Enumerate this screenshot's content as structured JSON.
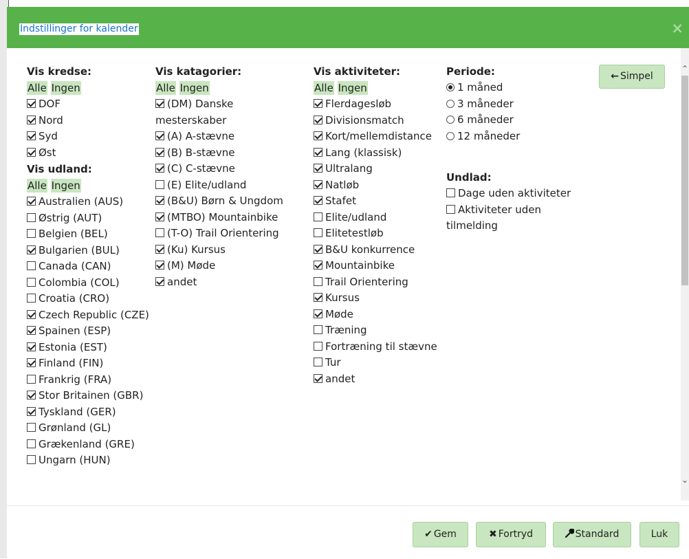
{
  "dialog": {
    "title": "Indstillinger for kalender",
    "close_symbol": "×",
    "simpel_label": "Simpel",
    "simpel_icon": "←"
  },
  "select_all_label": "Alle",
  "select_none_label": "Ingen",
  "kredse": {
    "heading": "Vis kredse:",
    "items": [
      {
        "label": "DOF",
        "checked": true
      },
      {
        "label": "Nord",
        "checked": true
      },
      {
        "label": "Syd",
        "checked": true
      },
      {
        "label": "Øst",
        "checked": true
      }
    ]
  },
  "udland": {
    "heading": "Vis udland:",
    "items": [
      {
        "label": "Australien (AUS)",
        "checked": true
      },
      {
        "label": "Østrig (AUT)",
        "checked": false
      },
      {
        "label": "Belgien (BEL)",
        "checked": false
      },
      {
        "label": "Bulgarien (BUL)",
        "checked": true
      },
      {
        "label": "Canada (CAN)",
        "checked": false
      },
      {
        "label": "Colombia (COL)",
        "checked": false
      },
      {
        "label": "Croatia (CRO)",
        "checked": false
      },
      {
        "label": "Czech Republic (CZE)",
        "checked": true
      },
      {
        "label": "Spainen (ESP)",
        "checked": true
      },
      {
        "label": "Estonia (EST)",
        "checked": true
      },
      {
        "label": "Finland (FIN)",
        "checked": true
      },
      {
        "label": "Frankrig (FRA)",
        "checked": false
      },
      {
        "label": "Stor Britainen (GBR)",
        "checked": true
      },
      {
        "label": "Tyskland (GER)",
        "checked": true
      },
      {
        "label": "Grønland (GL)",
        "checked": false
      },
      {
        "label": "Grækenland (GRE)",
        "checked": false
      },
      {
        "label": "Ungarn (HUN)",
        "checked": false
      }
    ]
  },
  "kategorier": {
    "heading": "Vis katagorier:",
    "items": [
      {
        "label": "(DM) Danske mesterskaber",
        "checked": true
      },
      {
        "label": "(A) A-stævne",
        "checked": true
      },
      {
        "label": "(B) B-stævne",
        "checked": true
      },
      {
        "label": "(C) C-stævne",
        "checked": true
      },
      {
        "label": "(E) Elite/udland",
        "checked": false
      },
      {
        "label": "(B&U) Børn & Ungdom",
        "checked": true
      },
      {
        "label": "(MTBO) Mountainbike",
        "checked": true
      },
      {
        "label": "(T-O) Trail Orientering",
        "checked": false
      },
      {
        "label": "(Ku) Kursus",
        "checked": true
      },
      {
        "label": "(M) Møde",
        "checked": true
      },
      {
        "label": "andet",
        "checked": true
      }
    ]
  },
  "aktiviteter": {
    "heading": "Vis aktiviteter:",
    "items": [
      {
        "label": "Flerdagesløb",
        "checked": true
      },
      {
        "label": "Divisionsmatch",
        "checked": true
      },
      {
        "label": "Kort/mellemdistance",
        "checked": true
      },
      {
        "label": "Lang (klassisk)",
        "checked": true
      },
      {
        "label": "Ultralang",
        "checked": true
      },
      {
        "label": "Natløb",
        "checked": true
      },
      {
        "label": "Stafet",
        "checked": true
      },
      {
        "label": "Elite/udland",
        "checked": false
      },
      {
        "label": "Elitetestløb",
        "checked": false
      },
      {
        "label": "B&U konkurrence",
        "checked": true
      },
      {
        "label": "Mountainbike",
        "checked": true
      },
      {
        "label": "Trail Orientering",
        "checked": false
      },
      {
        "label": "Kursus",
        "checked": true
      },
      {
        "label": "Møde",
        "checked": true
      },
      {
        "label": "Træning",
        "checked": false
      },
      {
        "label": "Fortræning til stævne",
        "checked": false
      },
      {
        "label": "Tur",
        "checked": false
      },
      {
        "label": "andet",
        "checked": true
      }
    ]
  },
  "periode": {
    "heading": "Periode:",
    "options": [
      {
        "label": "1 måned",
        "selected": true
      },
      {
        "label": "3 måneder",
        "selected": false
      },
      {
        "label": "6 måneder",
        "selected": false
      },
      {
        "label": "12 måneder",
        "selected": false
      }
    ]
  },
  "undlad": {
    "heading": "Undlad:",
    "items": [
      {
        "label": "Dage uden aktiviteter",
        "checked": false
      },
      {
        "label": "Aktiviteter uden tilmelding",
        "checked": false
      }
    ]
  },
  "footer": {
    "gem_label": "Gem",
    "gem_icon": "✔",
    "fortryd_label": "Fortryd",
    "fortryd_icon": "✖",
    "standard_label": "Standard",
    "standard_icon": "wrench",
    "luk_label": "Luk"
  }
}
